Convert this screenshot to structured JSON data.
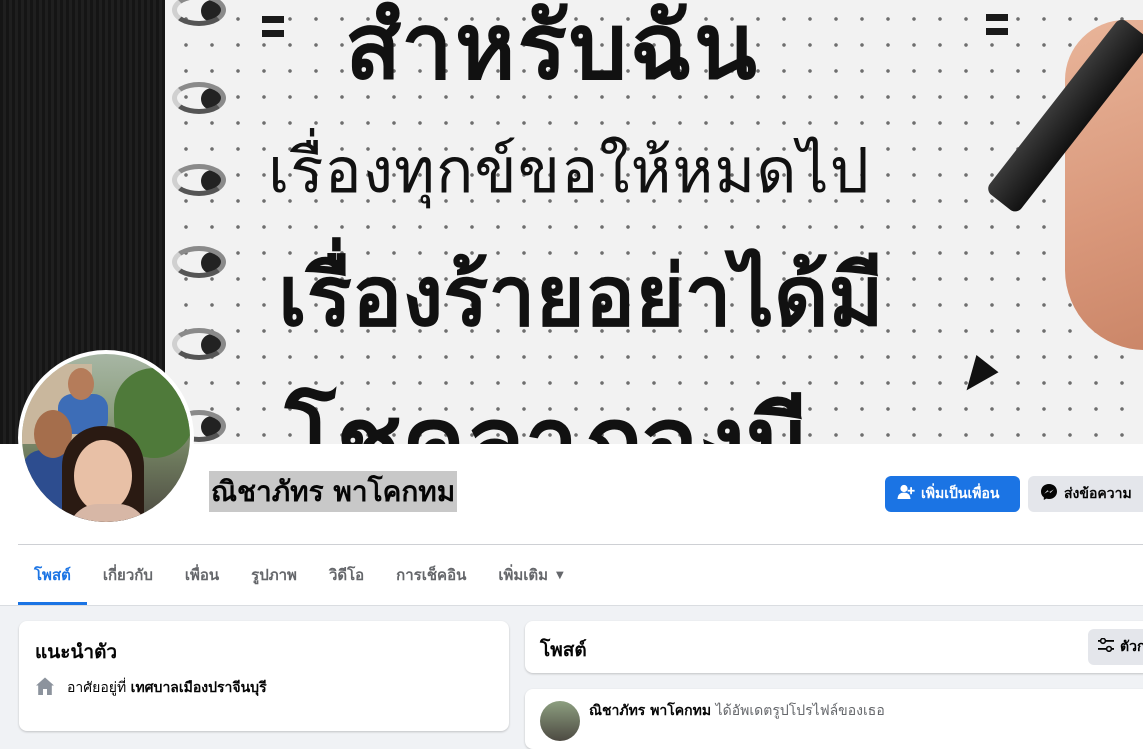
{
  "cover": {
    "line1": "สำหรับฉัน",
    "line2": "เรื่องทุกข์ขอให้หมดไป",
    "line3": "เรื่องร้ายอย่าได้มี",
    "line4": "โชคลาภจงมี"
  },
  "profile": {
    "name": "ณิชาภัทร พาโคกทม"
  },
  "actions": {
    "add_friend": "เพิ่มเป็นเพื่อน",
    "message": "ส่งข้อความ"
  },
  "tabs": [
    {
      "label": "โพสต์"
    },
    {
      "label": "เกี่ยวกับ"
    },
    {
      "label": "เพื่อน"
    },
    {
      "label": "รูปภาพ"
    },
    {
      "label": "วิดีโอ"
    },
    {
      "label": "การเช็คอิน"
    },
    {
      "label": "เพิ่มเติม"
    }
  ],
  "intro": {
    "title": "แนะนำตัว",
    "lives_prefix": "อาศัยอยู่ที่",
    "lives_place": "เทศบาลเมืองปราจีนบุรี"
  },
  "posts": {
    "title": "โพสต์",
    "filter_label": "ตัวกรอง"
  },
  "post": {
    "author": "ณิชาภัทร พาโคกทม",
    "action": "ได้อัพเดตรูปโปรไฟล์ของเธอ"
  },
  "colors": {
    "accent": "#1b74e4",
    "page_bg": "#f0f2f5",
    "button_grey": "#e4e6eb"
  }
}
